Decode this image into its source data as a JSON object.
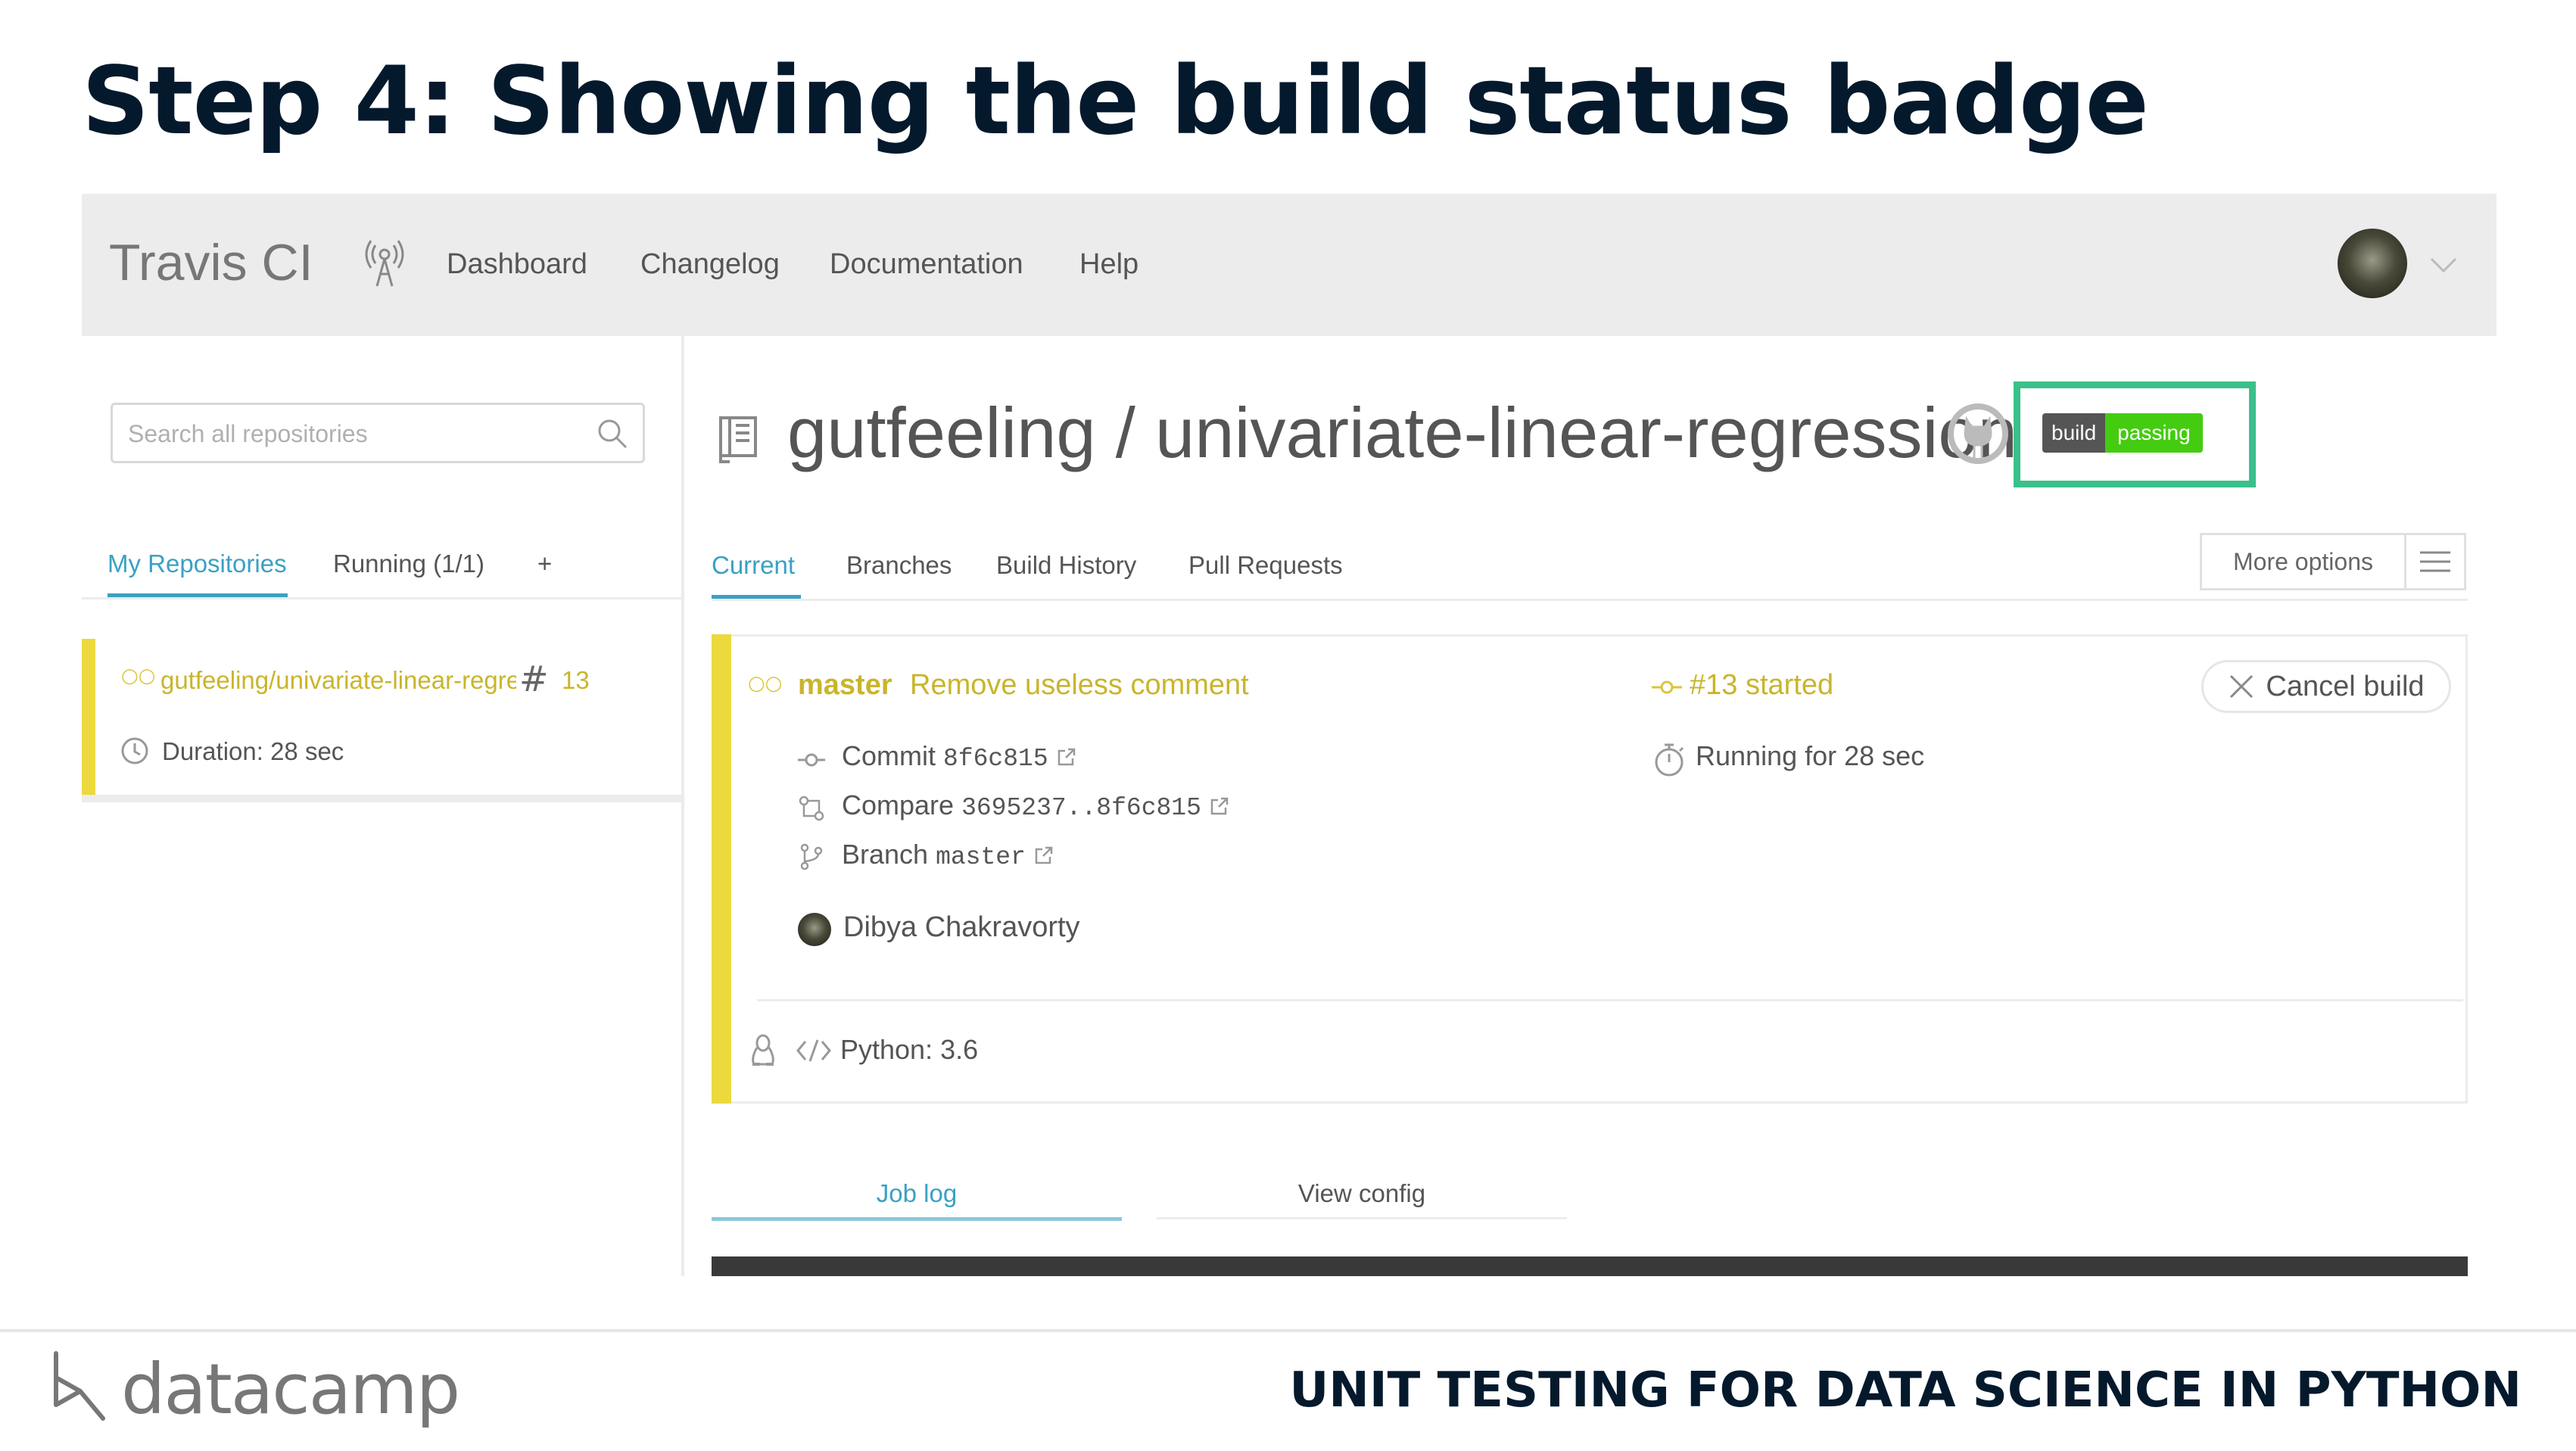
{
  "slide": {
    "title": "Step 4: Showing the build status badge",
    "footer_brand": "datacamp",
    "course_title": "UNIT TESTING FOR DATA SCIENCE IN PYTHON"
  },
  "travis": {
    "logo": "Travis CI",
    "nav": [
      "Dashboard",
      "Changelog",
      "Documentation",
      "Help"
    ],
    "search": {
      "placeholder": "Search all repositories"
    },
    "sidebar_tabs": {
      "my_repositories": "My Repositories",
      "running": "Running (1/1)",
      "add": "+"
    },
    "repo_card": {
      "name": "gutfeeling/univariate-linear-regression",
      "build_number": "13",
      "duration": "Duration: 28 sec"
    },
    "repo_title": "gutfeeling / univariate-linear-regression",
    "badge": {
      "left": "build",
      "right": "passing"
    },
    "main_tabs": [
      "Current",
      "Branches",
      "Build History",
      "Pull Requests"
    ],
    "more_options": "More options",
    "build": {
      "branch": "master",
      "message": "Remove useless comment",
      "status": "#13 started",
      "cancel": "Cancel build",
      "commit_label": "Commit",
      "commit_hash": "8f6c815",
      "compare_label": "Compare",
      "compare_range": "3695237..8f6c815",
      "branch_label": "Branch",
      "branch_value": "master",
      "running": "Running for 28 sec",
      "author": "Dibya Chakravorty",
      "language": "Python: 3.6"
    },
    "bottom_tabs": {
      "job_log": "Job log",
      "view_config": "View config"
    }
  },
  "colors": {
    "accent_blue": "#3aa1c4",
    "build_yellow": "#ecd93e",
    "badge_green": "#44cc11",
    "highlight_green": "#3ac08a",
    "title_navy": "#05192d"
  }
}
